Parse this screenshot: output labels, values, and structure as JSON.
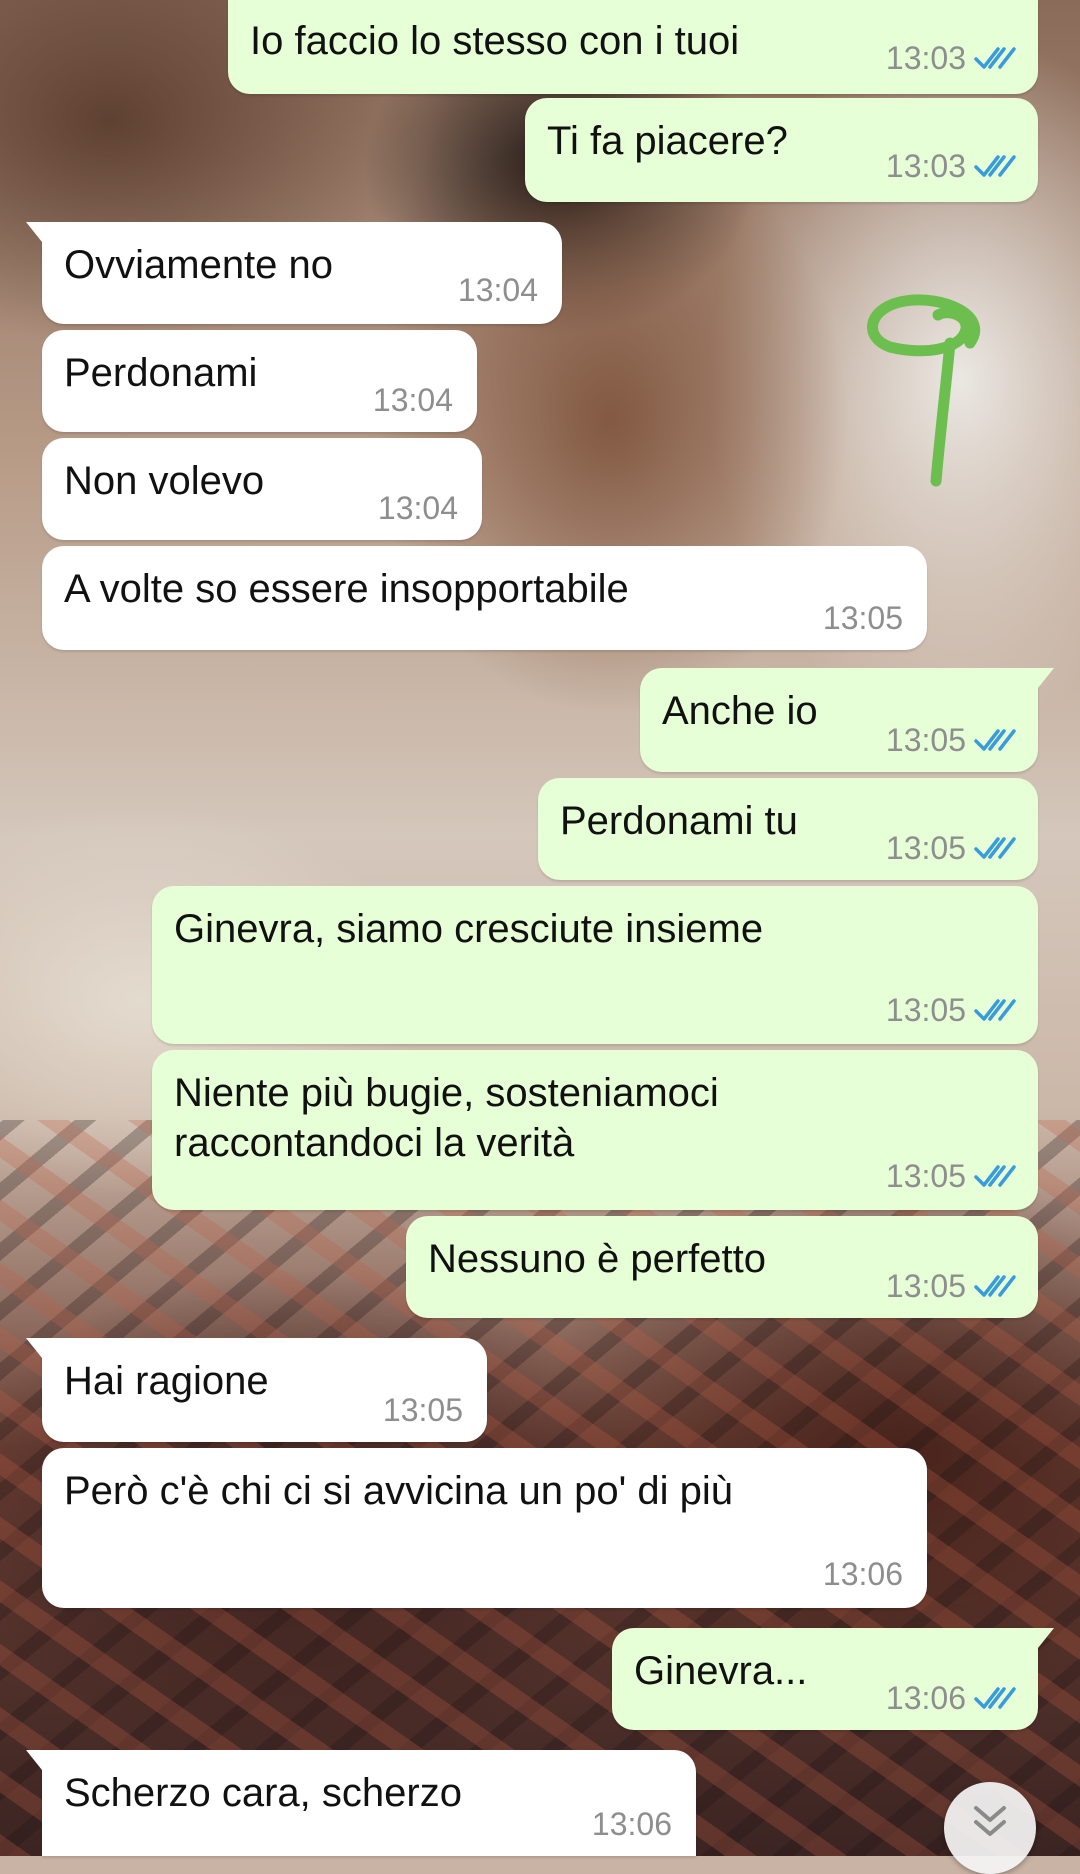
{
  "messages": [
    {
      "id": 1,
      "dir": "out",
      "text": "Io faccio lo stesso con i tuoi",
      "time": "13:03",
      "status": "read"
    },
    {
      "id": 2,
      "dir": "out",
      "text": "Ti fa piacere?",
      "time": "13:03",
      "status": "read"
    },
    {
      "id": 3,
      "dir": "in",
      "text": "Ovviamente no",
      "time": "13:04"
    },
    {
      "id": 4,
      "dir": "in",
      "text": "Perdonami",
      "time": "13:04"
    },
    {
      "id": 5,
      "dir": "in",
      "text": "Non volevo",
      "time": "13:04"
    },
    {
      "id": 6,
      "dir": "in",
      "text": "A volte so essere insopportabile",
      "time": "13:05"
    },
    {
      "id": 7,
      "dir": "out",
      "text": "Anche io",
      "time": "13:05",
      "status": "read"
    },
    {
      "id": 8,
      "dir": "out",
      "text": "Perdonami tu",
      "time": "13:05",
      "status": "read"
    },
    {
      "id": 9,
      "dir": "out",
      "text": "Ginevra, siamo cresciute insieme",
      "time": "13:05",
      "status": "read"
    },
    {
      "id": 10,
      "dir": "out",
      "text": "Niente più bugie, sosteniamoci\nraccontandoci la verità",
      "time": "13:05",
      "status": "read"
    },
    {
      "id": 11,
      "dir": "out",
      "text": "Nessuno è perfetto",
      "time": "13:05",
      "status": "read"
    },
    {
      "id": 12,
      "dir": "in",
      "text": "Hai ragione",
      "time": "13:05"
    },
    {
      "id": 13,
      "dir": "in",
      "text": "Però c'è chi ci si avvicina un po' di più",
      "time": "13:06"
    },
    {
      "id": 14,
      "dir": "out",
      "text": "Ginevra...",
      "time": "13:06",
      "status": "read"
    },
    {
      "id": 15,
      "dir": "in",
      "text": "Scherzo cara, scherzo",
      "time": "13:06"
    }
  ],
  "icons": {
    "read_receipt": "double-check-icon",
    "scroll_down": "double-chevron-down-icon",
    "annotation": "hand-drawn-annotation"
  },
  "colors": {
    "outgoing_bubble": "#e6ffd6",
    "incoming_bubble": "#ffffff",
    "timestamp": "#8e8e8e",
    "read_ticks": "#3a9bdc",
    "annotation": "#6cbf4e"
  }
}
